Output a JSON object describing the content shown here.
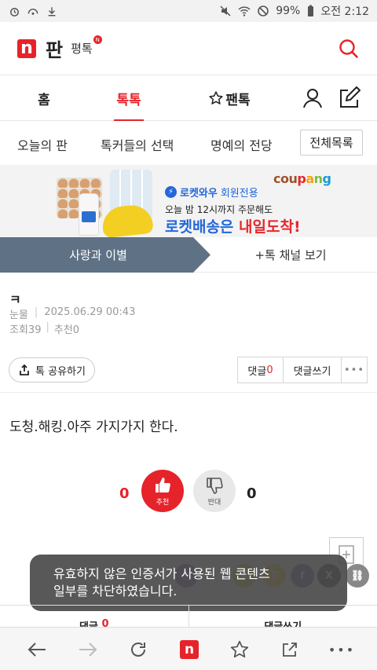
{
  "statusbar": {
    "battery": "99%",
    "time": "오전 2:12",
    "icons": [
      "alarm-icon",
      "signal-icon",
      "download-icon",
      "mute-icon",
      "wifi-icon",
      "block-icon",
      "battery-icon"
    ]
  },
  "header": {
    "logo_letter": "n",
    "logo_text": "판",
    "pt_label": "평톡",
    "pt_badge": "N"
  },
  "main_nav": {
    "items": [
      {
        "label": "홈"
      },
      {
        "label": "톡톡"
      },
      {
        "label": "팬톡"
      }
    ]
  },
  "sub_nav": {
    "items": [
      {
        "label": "오늘의 판"
      },
      {
        "label": "톡커들의 선택"
      },
      {
        "label": "명예의 전당"
      }
    ],
    "all_label": "전체목록"
  },
  "ad": {
    "brand": [
      "cou",
      "p",
      "a",
      "n",
      "g"
    ],
    "line1_bold": "로켓와우",
    "line1_rest": "회원전용",
    "line2": "오늘 밤 12시까지 주문해도",
    "line3_blue": "로켓배송은",
    "line3_red": "내일도착!"
  },
  "channel": {
    "category": "사랑과 이별",
    "more_label": "+톡 채널 보기"
  },
  "post": {
    "title": "ㅋ",
    "author": "눈물",
    "date": "2025.06.29 00:43",
    "views": "조회39",
    "recommends": "추천0",
    "body": "도청.해킹.아주 가지가지 한다."
  },
  "share": {
    "label": "톡 공유하기"
  },
  "comments": {
    "label": "댓글",
    "count": "0",
    "write_label": "댓글쓰기",
    "more": "•••"
  },
  "vote": {
    "up_count": "0",
    "up_label": "추천",
    "down_label": "반대",
    "down_count": "0"
  },
  "toast": {
    "line1": "유효하지 않은 인증서가 사용된 웹 콘텐츠",
    "line2": "일부를 차단하였습니다."
  },
  "bottom_comment": {
    "comment_label": "댓글",
    "comment_count": "0",
    "write_label": "댓글쓰기"
  },
  "browser": {
    "n_label": "n",
    "more": "•••"
  },
  "colors": {
    "brand_red": "#e6232a",
    "channel_bg": "#5f7185",
    "coupang_blue": "#2367d9"
  }
}
